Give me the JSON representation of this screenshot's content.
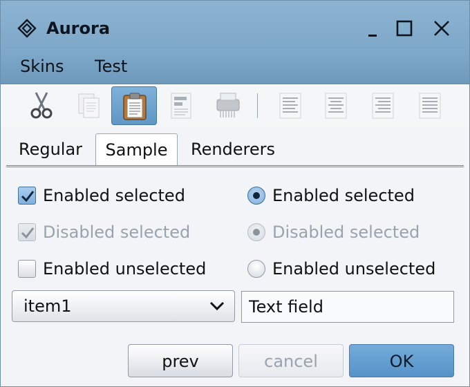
{
  "window": {
    "title": "Aurora",
    "icon": "diamond-logo-icon",
    "controls": [
      "minimize-icon",
      "maximize-icon",
      "close-icon"
    ]
  },
  "menu": {
    "items": [
      "Skins",
      "Test"
    ]
  },
  "toolbar": {
    "items": [
      {
        "icon": "cut-icon",
        "active": false
      },
      {
        "icon": "copy-icon",
        "active": false
      },
      {
        "icon": "paste-icon",
        "active": true
      },
      {
        "icon": "document-icon",
        "active": false
      },
      {
        "icon": "printer-icon",
        "active": false
      },
      {
        "icon": "align-left-icon",
        "active": false
      },
      {
        "icon": "align-center-icon",
        "active": false
      },
      {
        "icon": "align-right-icon",
        "active": false
      },
      {
        "icon": "align-justify-icon",
        "active": false
      }
    ]
  },
  "tabs": {
    "items": [
      "Regular",
      "Sample",
      "Renderers"
    ],
    "selected": "Sample"
  },
  "checkboxes": [
    {
      "label": "Enabled selected",
      "checked": true,
      "enabled": true
    },
    {
      "label": "Disabled selected",
      "checked": true,
      "enabled": false
    },
    {
      "label": "Enabled unselected",
      "checked": false,
      "enabled": true
    }
  ],
  "radios": [
    {
      "label": "Enabled selected",
      "checked": true,
      "enabled": true
    },
    {
      "label": "Disabled selected",
      "checked": true,
      "enabled": false
    },
    {
      "label": "Enabled unselected",
      "checked": false,
      "enabled": true
    }
  ],
  "combo": {
    "value": "item1"
  },
  "textfield": {
    "value": "Text field"
  },
  "buttons": {
    "prev": "prev",
    "cancel": "cancel",
    "ok": "OK"
  },
  "colors": {
    "title_bar": "#85aed0",
    "accent": "#5f97c6",
    "disabled_text": "#9aa3ad"
  }
}
